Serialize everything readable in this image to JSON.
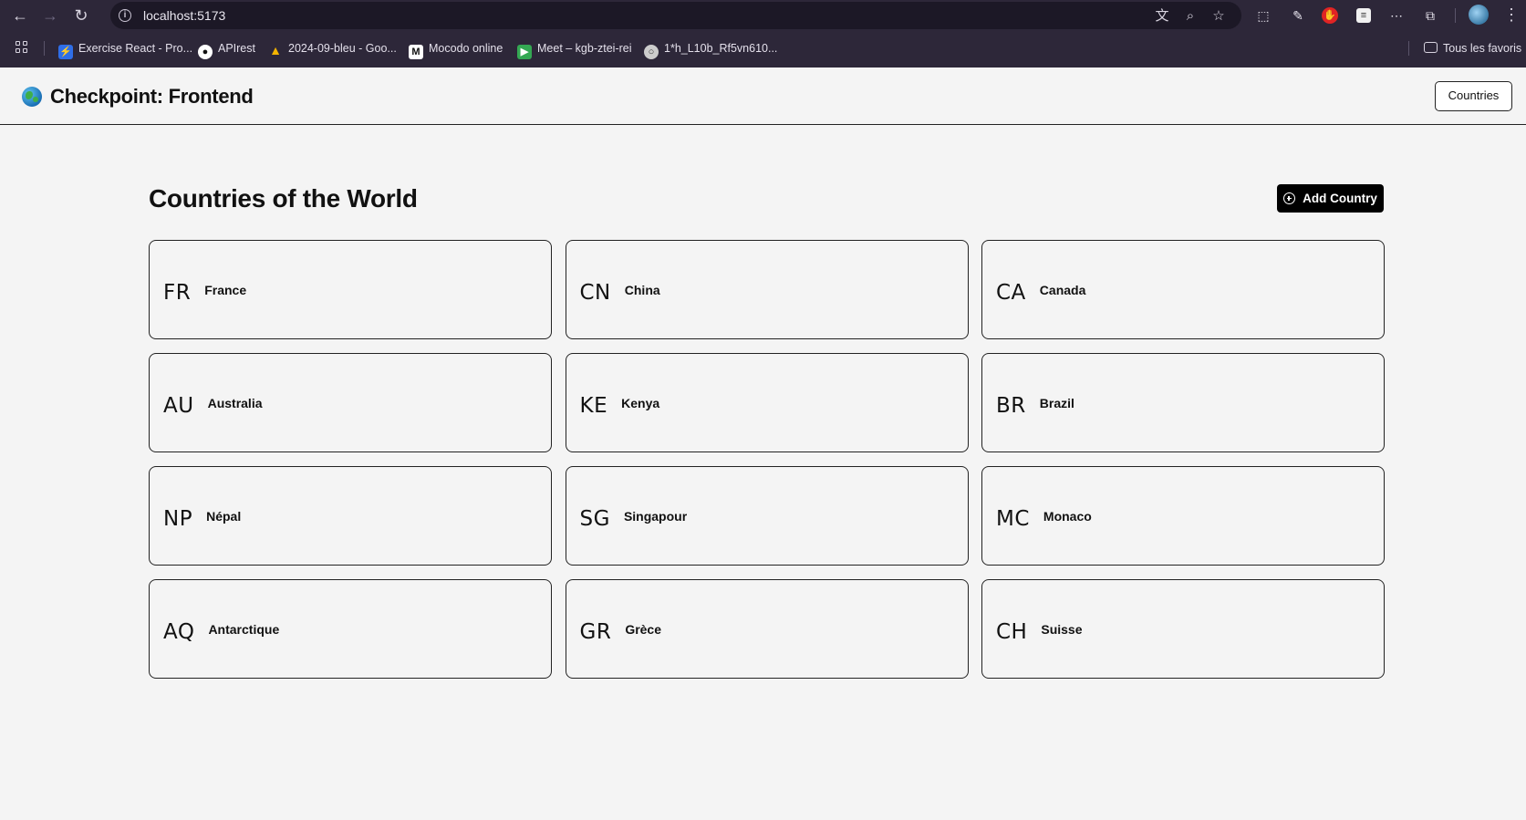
{
  "browser": {
    "url": "localhost:5173",
    "bookmarks": [
      {
        "label": "Exercise React - Pro...",
        "icon": "bolt-icon",
        "color": "#2f6ee8"
      },
      {
        "label": "APIrest",
        "icon": "github-icon",
        "color": "#ffffff"
      },
      {
        "label": "2024-09-bleu - Goo...",
        "icon": "drive-icon",
        "color": "#f4b400"
      },
      {
        "label": "Mocodo online",
        "icon": "mocodo-icon",
        "color": "#ffffff"
      },
      {
        "label": "Meet – kgb-ztei-rei",
        "icon": "meet-icon",
        "color": "#34a853"
      },
      {
        "label": "1*h_L10b_Rf5vn610...",
        "icon": "globe-icon",
        "color": "#cccccc"
      }
    ],
    "all_bookmarks_label": "Tous les favoris"
  },
  "header": {
    "title": "Checkpoint: Frontend",
    "nav_countries": "Countries"
  },
  "main": {
    "title": "Countries of the World",
    "add_button": "Add Country",
    "countries": [
      {
        "code": "FR",
        "name": "France"
      },
      {
        "code": "CN",
        "name": "China"
      },
      {
        "code": "CA",
        "name": "Canada"
      },
      {
        "code": "AU",
        "name": "Australia"
      },
      {
        "code": "KE",
        "name": "Kenya"
      },
      {
        "code": "BR",
        "name": "Brazil"
      },
      {
        "code": "NP",
        "name": "Népal"
      },
      {
        "code": "SG",
        "name": "Singapour"
      },
      {
        "code": "MC",
        "name": "Monaco"
      },
      {
        "code": "AQ",
        "name": "Antarctique"
      },
      {
        "code": "GR",
        "name": "Grèce"
      },
      {
        "code": "CH",
        "name": "Suisse"
      }
    ]
  }
}
